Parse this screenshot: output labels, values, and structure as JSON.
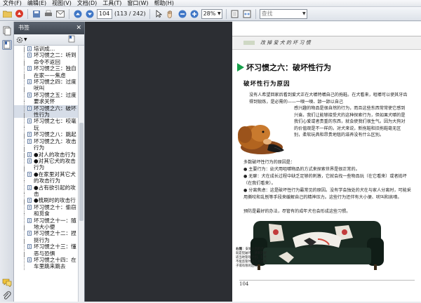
{
  "menubar": [
    "文件(F)",
    "编辑(E)",
    "视图(V)",
    "文档(D)",
    "工具(T)",
    "窗口(W)",
    "帮助(H)"
  ],
  "toolbar": {
    "page_current": "104",
    "page_total": "(113 / 242)",
    "zoom": "28%",
    "search_placeholder": "查找"
  },
  "bookmarks": {
    "header": "书签",
    "items": [
      {
        "label": "培训成…"
      },
      {
        "label": "坏习惯之二：听到命令不返回"
      },
      {
        "label": "坏习惯之三：独自在家——焦虑"
      },
      {
        "label": "坏习惯之四：过度吠叫"
      },
      {
        "label": "坏习惯之五：过度要求关怀"
      },
      {
        "label": "坏习惯之六：破坏性行为",
        "selected": true
      },
      {
        "label": "坏习惯之七：咬毫玩"
      },
      {
        "label": "坏习惯之八：跳起"
      },
      {
        "label": "坏习惯之九：攻击行为"
      },
      {
        "label": "●对人的攻击行为"
      },
      {
        "label": "●对其它犬的攻击行为"
      },
      {
        "label": "●在家里对其它犬的攻击行为"
      },
      {
        "label": "●占有欲引起的攻击"
      },
      {
        "label": "●梳刷时的攻击行"
      },
      {
        "label": "坏习惯之十：偷窃和觅食"
      },
      {
        "label": "坏习惯之十一：随地大小便"
      },
      {
        "label": "坏习惯之十二：捏挺行为"
      },
      {
        "label": "坏习惯之十三：懂恶与恐惧"
      },
      {
        "label": "坏习惯之十四：在车里跳来跳去"
      }
    ]
  },
  "page": {
    "header": "改 掉 爱 犬 的 坏 习 惯",
    "chapter_title": "坏习惯之六：破坏性行为",
    "section_title": "破坏性行为原因",
    "para1": "没有人希望回家后看到爱犬正在大嚼特嚼自己的拖鞋。在犬看来，咀嚼可以使其牙齿得到锻炼，是必需的——一嗅一嗅、舔一舔以自己",
    "para1b": "感兴趣的物品是很自然的行为，而且这些东西常常使它感到兴奋。我们让能够接受犬的这种探索行为，但如果犬嚼的是我们心爱或者贵重的东西，就会使我们很生气。因为大狗对的价值观是不一样的。对犬来说，新拖鞋和旧拖鞋毫无区别，柔软玩具和昂贵地毯的滋养没有什么区别。",
    "para2": "多数破坏性行为的原因是：",
    "para3": "● 主要行为：幼犬用咀嚼物品的方式来探索世界是很正常的。",
    "para4": "● 无聊：犬在成长过程中缺乏足够的刺激，它就会找一些物品玩（在它看来）或者捣坏（在我们看来）。",
    "para5": "● 分离焦虑：这是破坏性行为最常见的原因。没有学会独处的犬在与家人分离时，可能采用撕咬和乱刨等手段来缓解自己的精神压力。这些行为还伴有大小便、吠叫和哀嚎。",
    "para6": "预防是最好的办法，尽管有的成年犬也会形成这些习惯。",
    "caption_bold": "右图",
    "caption": "：安家以后的犬就是犯破坏，请制定好适当地管理计划，在犬不能监管时将它关进笼子或有限的区域。",
    "page_number": "104"
  },
  "colors": {
    "accent_green": "#16a04a",
    "doc_background": "#2c2e33",
    "panel_header": "#4a515c"
  }
}
